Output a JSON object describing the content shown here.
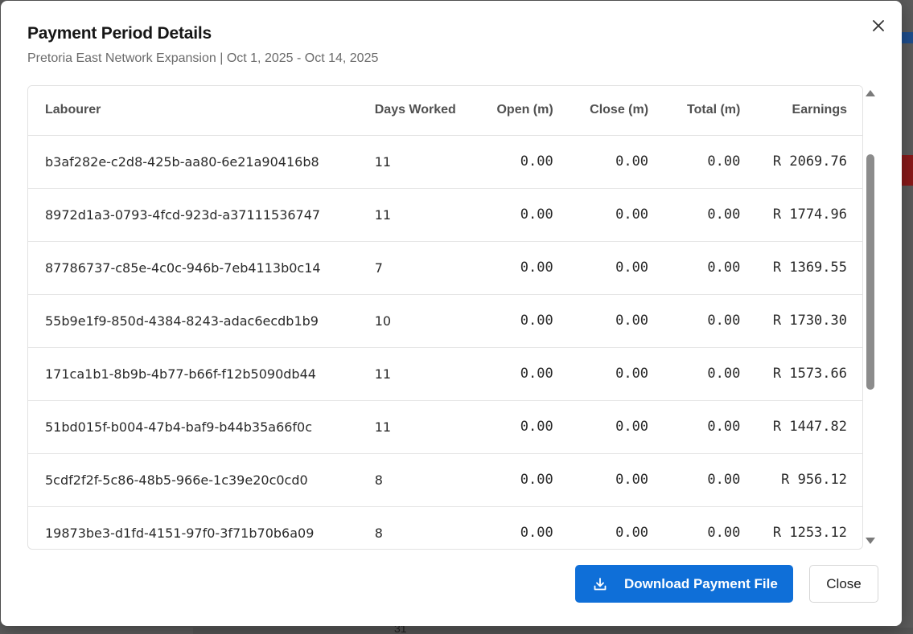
{
  "modal": {
    "title": "Payment Period Details",
    "subtitle": "Pretoria East Network Expansion | Oct 1, 2025 - Oct 14, 2025"
  },
  "table": {
    "headers": {
      "labourer": "Labourer",
      "days": "Days Worked",
      "open": "Open (m)",
      "close": "Close (m)",
      "total": "Total (m)",
      "earnings": "Earnings"
    },
    "rows": [
      {
        "labourer": "b3af282e-c2d8-425b-aa80-6e21a90416b8",
        "days": "11",
        "open": "0.00",
        "close": "0.00",
        "total": "0.00",
        "earnings": "R 2069.76"
      },
      {
        "labourer": "8972d1a3-0793-4fcd-923d-a37111536747",
        "days": "11",
        "open": "0.00",
        "close": "0.00",
        "total": "0.00",
        "earnings": "R 1774.96"
      },
      {
        "labourer": "87786737-c85e-4c0c-946b-7eb4113b0c14",
        "days": "7",
        "open": "0.00",
        "close": "0.00",
        "total": "0.00",
        "earnings": "R 1369.55"
      },
      {
        "labourer": "55b9e1f9-850d-4384-8243-adac6ecdb1b9",
        "days": "10",
        "open": "0.00",
        "close": "0.00",
        "total": "0.00",
        "earnings": "R 1730.30"
      },
      {
        "labourer": "171ca1b1-8b9b-4b77-b66f-f12b5090db44",
        "days": "11",
        "open": "0.00",
        "close": "0.00",
        "total": "0.00",
        "earnings": "R 1573.66"
      },
      {
        "labourer": "51bd015f-b004-47b4-baf9-b44b35a66f0c",
        "days": "11",
        "open": "0.00",
        "close": "0.00",
        "total": "0.00",
        "earnings": "R 1447.82"
      },
      {
        "labourer": "5cdf2f2f-5c86-48b5-966e-1c39e20c0cd0",
        "days": "8",
        "open": "0.00",
        "close": "0.00",
        "total": "0.00",
        "earnings": "R 956.12"
      },
      {
        "labourer": "19873be3-d1fd-4151-97f0-3f71b70b6a09",
        "days": "8",
        "open": "0.00",
        "close": "0.00",
        "total": "0.00",
        "earnings": "R 1253.12"
      }
    ]
  },
  "footer": {
    "download_label": "Download Payment File",
    "close_label": "Close"
  },
  "background": {
    "partial_text": "31"
  },
  "icons": {
    "close": "close-icon",
    "download": "download-icon",
    "scroll_up": "arrow-up-icon",
    "scroll_down": "arrow-down-icon"
  },
  "colors": {
    "primary": "#0f6fd8",
    "text": "#161616",
    "muted": "#6b6b6b"
  }
}
